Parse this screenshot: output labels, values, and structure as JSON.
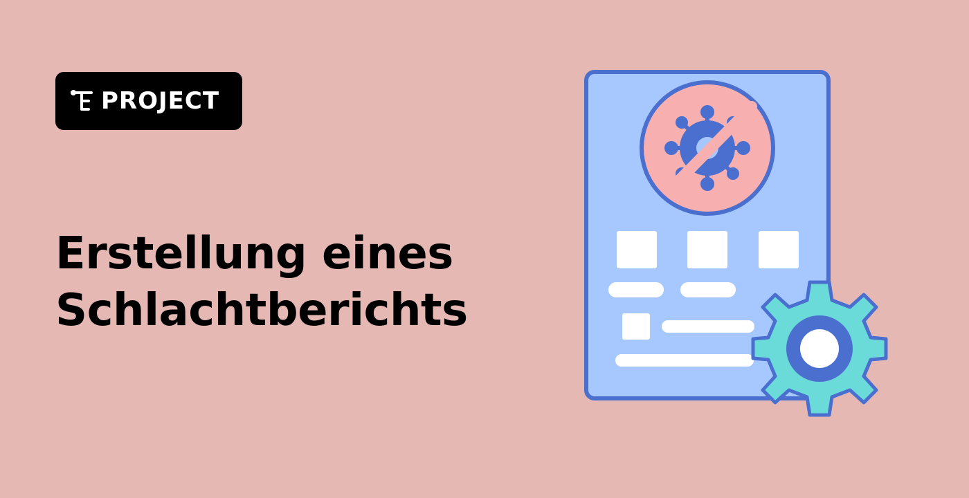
{
  "badge": {
    "label": "PROJECT",
    "icon": "tree-structure-icon"
  },
  "title": {
    "line1": "Erstellung eines",
    "line2": "Schlachtberichts"
  },
  "illustration": {
    "icons": [
      "document-icon",
      "no-virus-icon",
      "gear-icon"
    ]
  },
  "colors": {
    "background": "#E5B8B4",
    "badge": "#000000",
    "document_fill": "#A6C8FF",
    "outline": "#4A6FCF",
    "stop_circle": "#F7AFAF",
    "virus": "#4A6FCF",
    "gear": "#6ADBD9"
  }
}
